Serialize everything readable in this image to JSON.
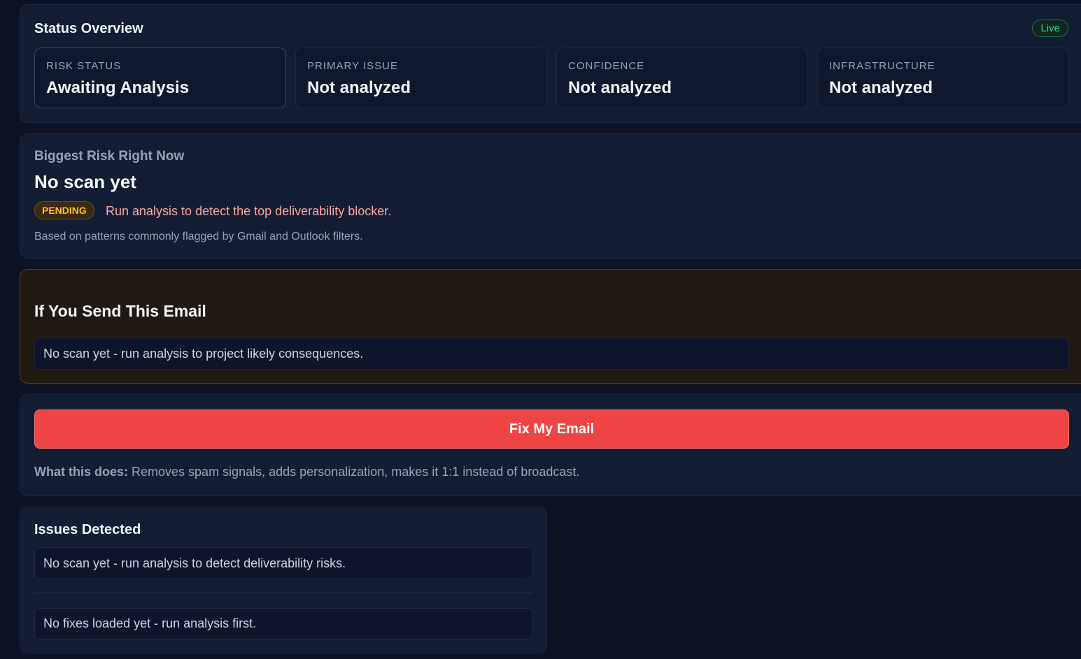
{
  "status_overview": {
    "title": "Status Overview",
    "live_label": "Live",
    "cards": [
      {
        "label": "RISK STATUS",
        "value": "Awaiting Analysis"
      },
      {
        "label": "PRIMARY ISSUE",
        "value": "Not analyzed"
      },
      {
        "label": "CONFIDENCE",
        "value": "Not analyzed"
      },
      {
        "label": "INFRASTRUCTURE",
        "value": "Not analyzed"
      }
    ]
  },
  "biggest_risk": {
    "kicker": "Biggest Risk Right Now",
    "headline": "No scan yet",
    "badge": "PENDING",
    "message": "Run analysis to detect the top deliverability blocker.",
    "note": "Based on patterns commonly flagged by Gmail and Outlook filters."
  },
  "consequences": {
    "title": "If You Send This Email",
    "message": "No scan yet - run analysis to project likely consequences."
  },
  "fix": {
    "button_label": "Fix My Email",
    "note_label": "What this does:",
    "note_text": "Removes spam signals, adds personalization, makes it 1:1 instead of broadcast."
  },
  "issues": {
    "title": "Issues Detected",
    "issues_message": "No scan yet - run analysis to detect deliverability risks.",
    "fixes_message": "No fixes loaded yet - run analysis first."
  },
  "colors": {
    "background": "#0f1424",
    "panel": "#141e33",
    "accent_red": "#ef4444",
    "live_green": "#34d399",
    "pending_amber": "#fbbf24"
  }
}
